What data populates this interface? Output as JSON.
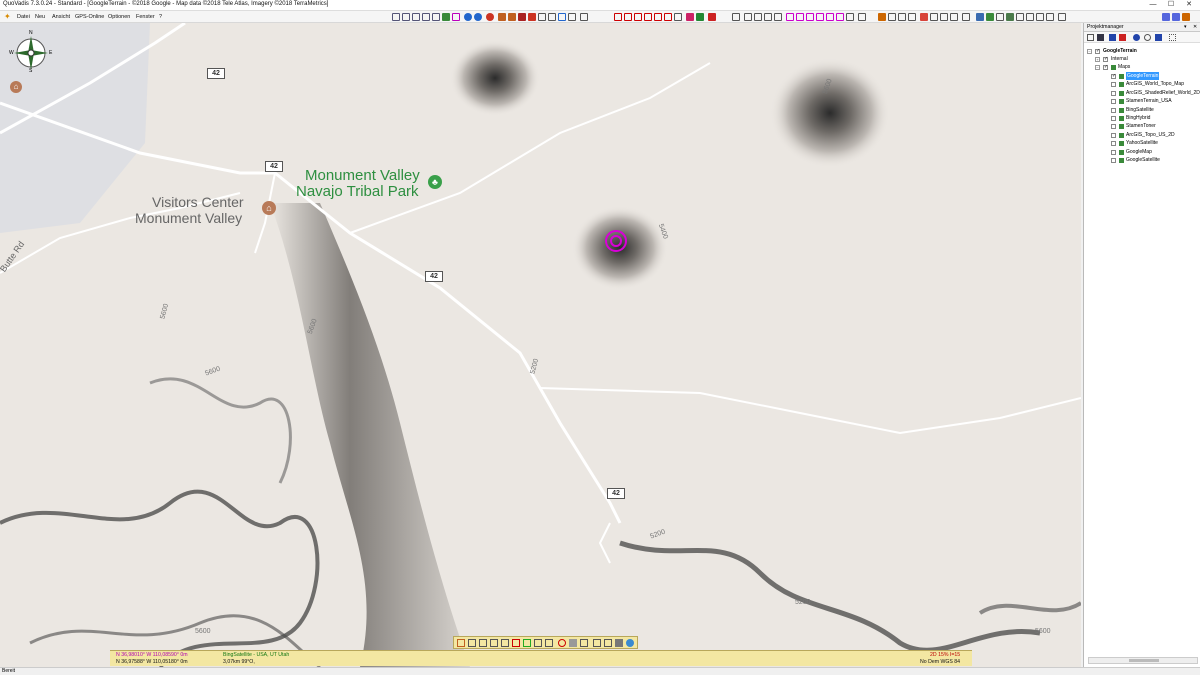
{
  "window": {
    "title": "QuoVadis 7.3.0.24 - Standard - [GoogleTerrain - ©2018 Google - Map data ©2018 Tele Atlas, Imagery ©2018 TerraMetrics]",
    "minimize": "—",
    "maximize": "☐",
    "close": "✕"
  },
  "menu": {
    "items": [
      "Datei",
      "Neu",
      "Ansicht",
      "GPS-Online",
      "Optionen",
      "Fenster",
      "?"
    ]
  },
  "map": {
    "place_labels": {
      "park_line1": "Monument Valley",
      "park_line2": "Navajo Tribal Park",
      "visitors_line1": "Visitors Center",
      "visitors_line2": "Monument Valley",
      "road": "Butte Rd"
    },
    "route_shields": [
      "42",
      "42",
      "42",
      "42"
    ],
    "contours": [
      "5600",
      "5600",
      "5600",
      "5200",
      "5200",
      "5200",
      "5600",
      "5400",
      "5600",
      "5600"
    ],
    "compass": {
      "n": "N",
      "e": "E",
      "s": "S",
      "w": "W"
    }
  },
  "status": {
    "coord1": "N 36,98010° W 110,08590° 0m",
    "coord2": "N 36,97588° W 110,05180° 0m",
    "map_source": "BingSatellite - USA, UT Utah",
    "distance": "3,07km 99°O,",
    "zoom": "2D 15% I=15",
    "dem": "No Dem WGS 84"
  },
  "panel": {
    "title": "Projektmanager",
    "pin": "▾",
    "close": "✕",
    "tree": {
      "root": "GoogleTerrain",
      "internal": "Internal",
      "maps": "Maps",
      "layers": [
        {
          "label": "GoogleTerrain",
          "checked": true,
          "selected": true
        },
        {
          "label": "ArcGIS_World_Topo_Map",
          "checked": false,
          "selected": false
        },
        {
          "label": "ArcGIS_ShadedRelief_World_2D",
          "checked": false,
          "selected": false
        },
        {
          "label": "StamenTerrain_USA",
          "checked": false,
          "selected": false
        },
        {
          "label": "BingSatellite",
          "checked": false,
          "selected": false
        },
        {
          "label": "BingHybrid",
          "checked": false,
          "selected": false
        },
        {
          "label": "StamenToner",
          "checked": false,
          "selected": false
        },
        {
          "label": "ArcGIS_Topo_US_2D",
          "checked": false,
          "selected": false
        },
        {
          "label": "YahooSatellite",
          "checked": false,
          "selected": false
        },
        {
          "label": "GoogleMap",
          "checked": false,
          "selected": false
        },
        {
          "label": "GoogleSatellite",
          "checked": false,
          "selected": false
        }
      ]
    }
  },
  "footer": {
    "status": "Bereit"
  },
  "colors": {
    "terrain": "#ebe7e2",
    "park_green": "#2e8f40",
    "target_marker": "#d800d8",
    "status_bg": "#f3e7a2",
    "selection": "#3399ff"
  }
}
